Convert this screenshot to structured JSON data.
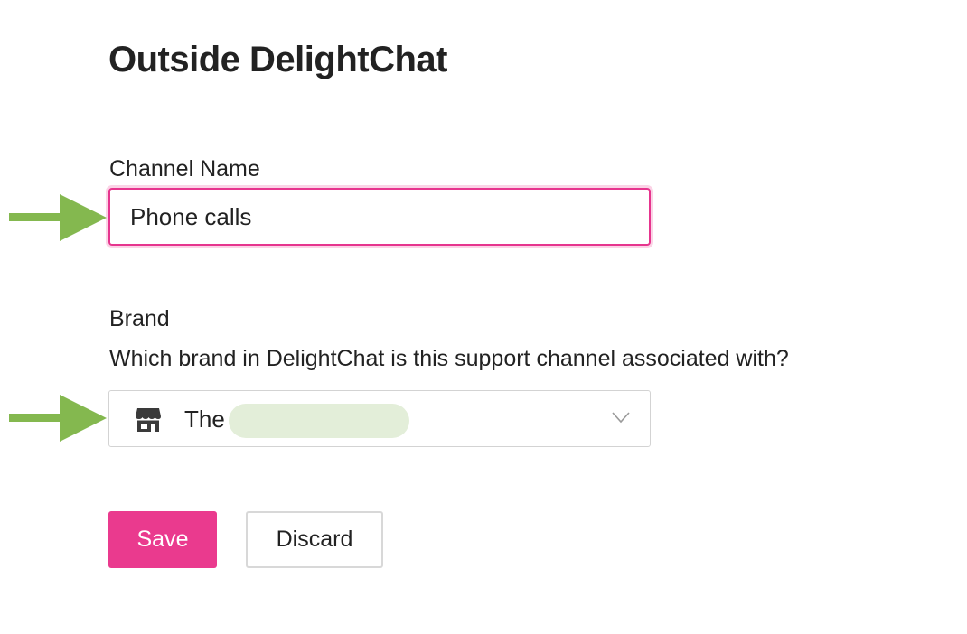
{
  "page": {
    "title": "Outside DelightChat"
  },
  "channel_name": {
    "label": "Channel Name",
    "value": "Phone calls"
  },
  "brand": {
    "label": "Brand",
    "help_text": "Which brand in DelightChat is this support channel associated with?",
    "selected_value": "The",
    "icon": "store-icon",
    "dropdown_icon": "chevron-down-icon"
  },
  "actions": {
    "save_label": "Save",
    "discard_label": "Discard"
  },
  "annotations": {
    "arrow_color": "#84b84f",
    "arrow_icon": "arrow-right-icon"
  },
  "colors": {
    "accent": "#ea3a8e",
    "focus_border": "#e6358e",
    "redaction": "#e3eed9"
  }
}
